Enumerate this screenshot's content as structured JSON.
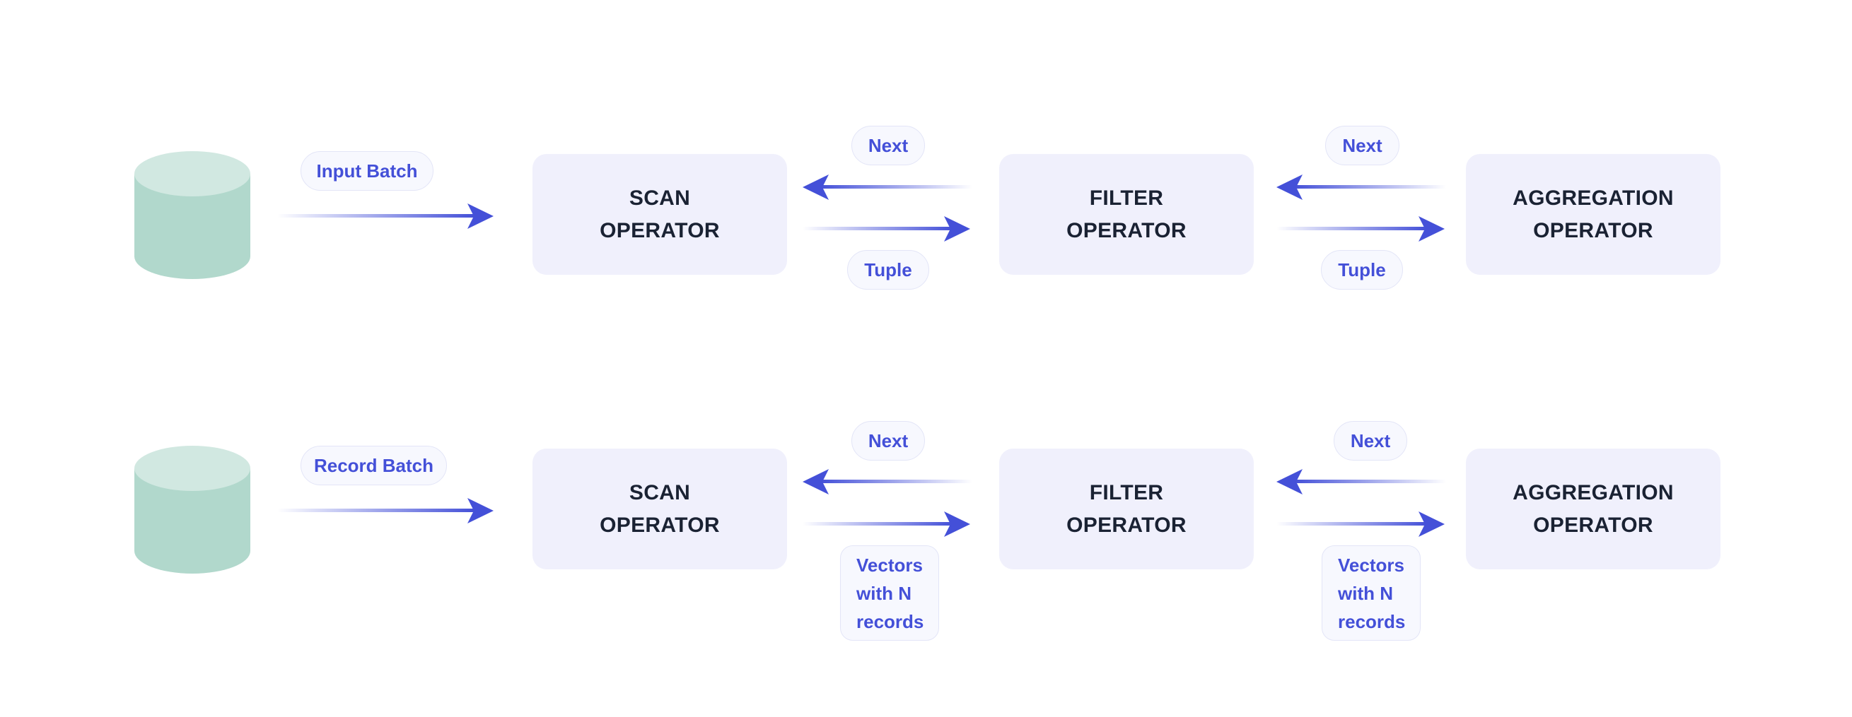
{
  "colors": {
    "arrow": "#4450d8",
    "operator_box": "#f0f0fc",
    "operator_text": "#1a2233",
    "pill_bg": "#f7f8fe",
    "pill_text": "#4450d8",
    "db_top": "#d1e8e1",
    "db_body": "#b1d8cc"
  },
  "rows": [
    {
      "source_label": "Input Batch",
      "operators": [
        {
          "line1": "SCAN",
          "line2": "OPERATOR"
        },
        {
          "line1": "FILTER",
          "line2": "OPERATOR"
        },
        {
          "line1": "AGGREGATION",
          "line2": "OPERATOR"
        }
      ],
      "links": [
        {
          "request": "Next",
          "response": [
            "Tuple"
          ]
        },
        {
          "request": "Next",
          "response": [
            "Tuple"
          ]
        }
      ]
    },
    {
      "source_label": "Record Batch",
      "operators": [
        {
          "line1": "SCAN",
          "line2": "OPERATOR"
        },
        {
          "line1": "FILTER",
          "line2": "OPERATOR"
        },
        {
          "line1": "AGGREGATION",
          "line2": "OPERATOR"
        }
      ],
      "links": [
        {
          "request": "Next",
          "response": [
            "Vectors",
            "with N",
            "records"
          ]
        },
        {
          "request": "Next",
          "response": [
            "Vectors",
            "with N",
            "records"
          ]
        }
      ]
    }
  ]
}
